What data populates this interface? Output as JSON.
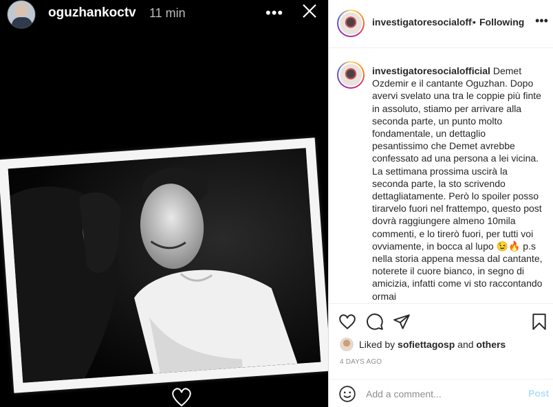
{
  "story": {
    "username": "oguzhankoctv",
    "time": "11 min",
    "more_label": "•••"
  },
  "post": {
    "header": {
      "username": "investigatoresocialofficial",
      "separator": "•",
      "follow_label": "Following",
      "more_label": "•••"
    },
    "caption": {
      "username": "investigatoresocialofficial",
      "text": "Demet Ozdemir e il cantante Oguzhan. Dopo avervi svelato una tra le coppie più finte in assoluto, stiamo per arrivare alla seconda parte, un punto molto fondamentale, un dettaglio pesantissimo che Demet avrebbe confessato ad una persona a lei vicina. La settimana prossima uscirà la seconda parte, la sto scrivendo dettagliatamente. Però lo spoiler posso tirarvelo fuori nel frattempo, questo post dovrà raggiungere almeno 10mila commenti, e lo tirerò fuori, per tutti voi ovviamente, in bocca al lupo 😉🔥 p.s nella storia appena messa dal cantante, noterete il cuore bianco, in segno di amicizia, infatti come vi sto raccontando ormai"
    },
    "likes": {
      "prefix": "Liked by",
      "user": "sofiettagosp",
      "conjunction": "and",
      "others": "others"
    },
    "timestamp": "4 DAYS AGO",
    "comment_box": {
      "placeholder": "Add a comment...",
      "post_label": "Post"
    },
    "colors": {
      "text": "#262626",
      "muted": "#8e8e8e",
      "post_disabled": "#b2dffc"
    }
  }
}
